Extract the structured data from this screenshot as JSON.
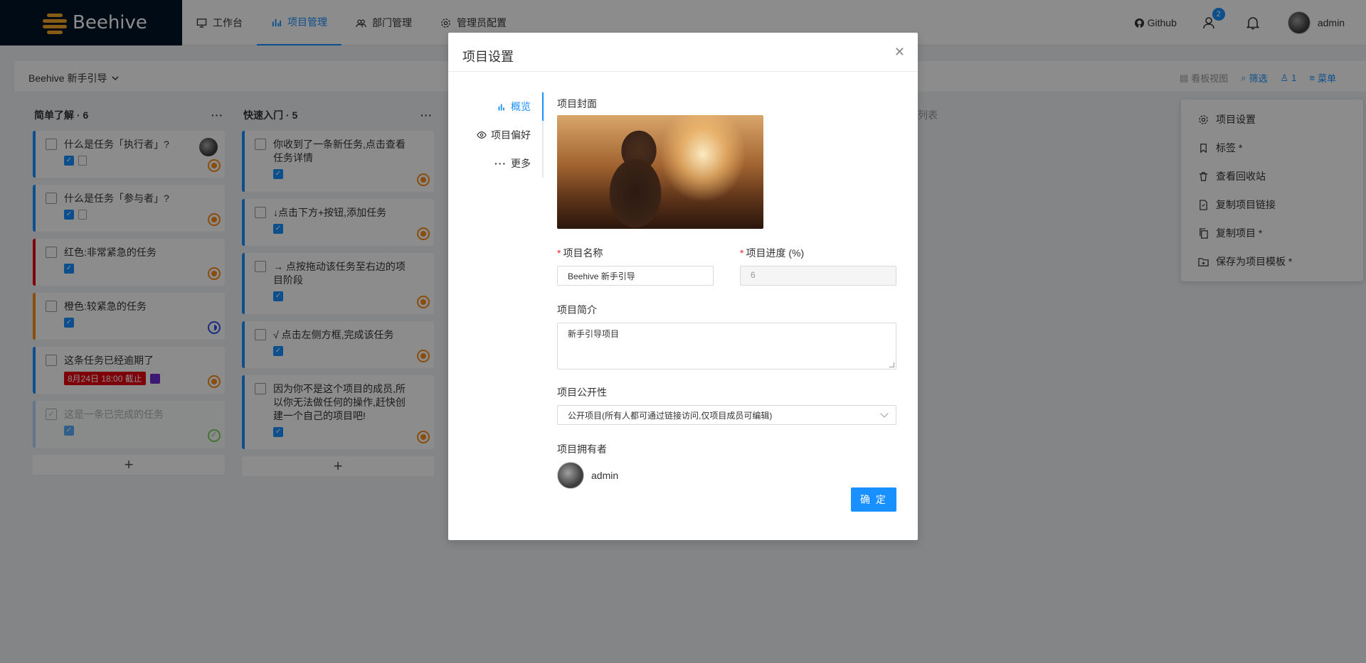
{
  "app": {
    "name": "Beehive"
  },
  "nav": [
    {
      "label": "工作台",
      "icon": "monitor-icon"
    },
    {
      "label": "项目管理",
      "icon": "bar-chart-icon",
      "active": true
    },
    {
      "label": "部门管理",
      "icon": "team-icon"
    },
    {
      "label": "管理员配置",
      "icon": "gear-icon"
    }
  ],
  "header": {
    "github_label": "Github",
    "notify_count": "2",
    "username": "admin"
  },
  "subbar": {
    "project_name": "Beehive 新手引导",
    "board_view": "看板视图",
    "filter": "筛选",
    "members": "1",
    "menu": "菜单"
  },
  "columns": [
    {
      "title": "简单了解 · 6",
      "cards": [
        {
          "title": "什么是任务「执行者」?"
        },
        {
          "title": "什么是任务「参与者」?"
        },
        {
          "title": "红色:非常紧急的任务"
        },
        {
          "title": "橙色:较紧急的任务"
        },
        {
          "title": "这条任务已经逾期了",
          "date": "8月24日 18:00 截止"
        },
        {
          "title": "这是一条已完成的任务"
        }
      ]
    },
    {
      "title": "快速入门 · 5",
      "cards": [
        {
          "title": "你收到了一条新任务,点击查看任务详情"
        },
        {
          "title": "↓点击下方+按钮,添加任务"
        },
        {
          "title": "→ 点按拖动该任务至右边的项目阶段"
        },
        {
          "title": "√ 点击左侧方框,完成该任务"
        },
        {
          "title": "因为你不是这个项目的成员,所以你无法做任何的操作,赶快创建一个自己的项目吧!"
        }
      ]
    }
  ],
  "list_hint": "列表",
  "dropdown": [
    {
      "label": "项目设置",
      "icon": "gear-icon"
    },
    {
      "label": "标签 *",
      "icon": "bookmark-icon"
    },
    {
      "label": "查看回收站",
      "icon": "trash-icon"
    },
    {
      "label": "复制项目链接",
      "icon": "link-file-icon"
    },
    {
      "label": "复制项目 *",
      "icon": "copy-icon"
    },
    {
      "label": "保存为项目模板 *",
      "icon": "folder-icon"
    }
  ],
  "modal": {
    "title": "项目设置",
    "tabs": [
      {
        "label": "概览",
        "icon": "bar-chart-icon",
        "active": true
      },
      {
        "label": "项目偏好",
        "icon": "eye-icon"
      },
      {
        "label": "更多",
        "icon": "ellipsis-icon"
      }
    ],
    "cover_label": "项目封面",
    "name_label": "项目名称",
    "name_value": "Beehive 新手引导",
    "progress_label": "项目进度 (%)",
    "progress_value": "6",
    "desc_label": "项目简介",
    "desc_value": "新手引导项目",
    "visibility_label": "项目公开性",
    "visibility_value": "公开项目(所有人都可通过链接访问,仅项目成员可编辑)",
    "owner_label": "项目拥有者",
    "owner_name": "admin",
    "ok_label": "确 定"
  },
  "colors": {
    "primary": "#1890ff",
    "urgent": "#e60012",
    "warn": "#fa8c16"
  }
}
